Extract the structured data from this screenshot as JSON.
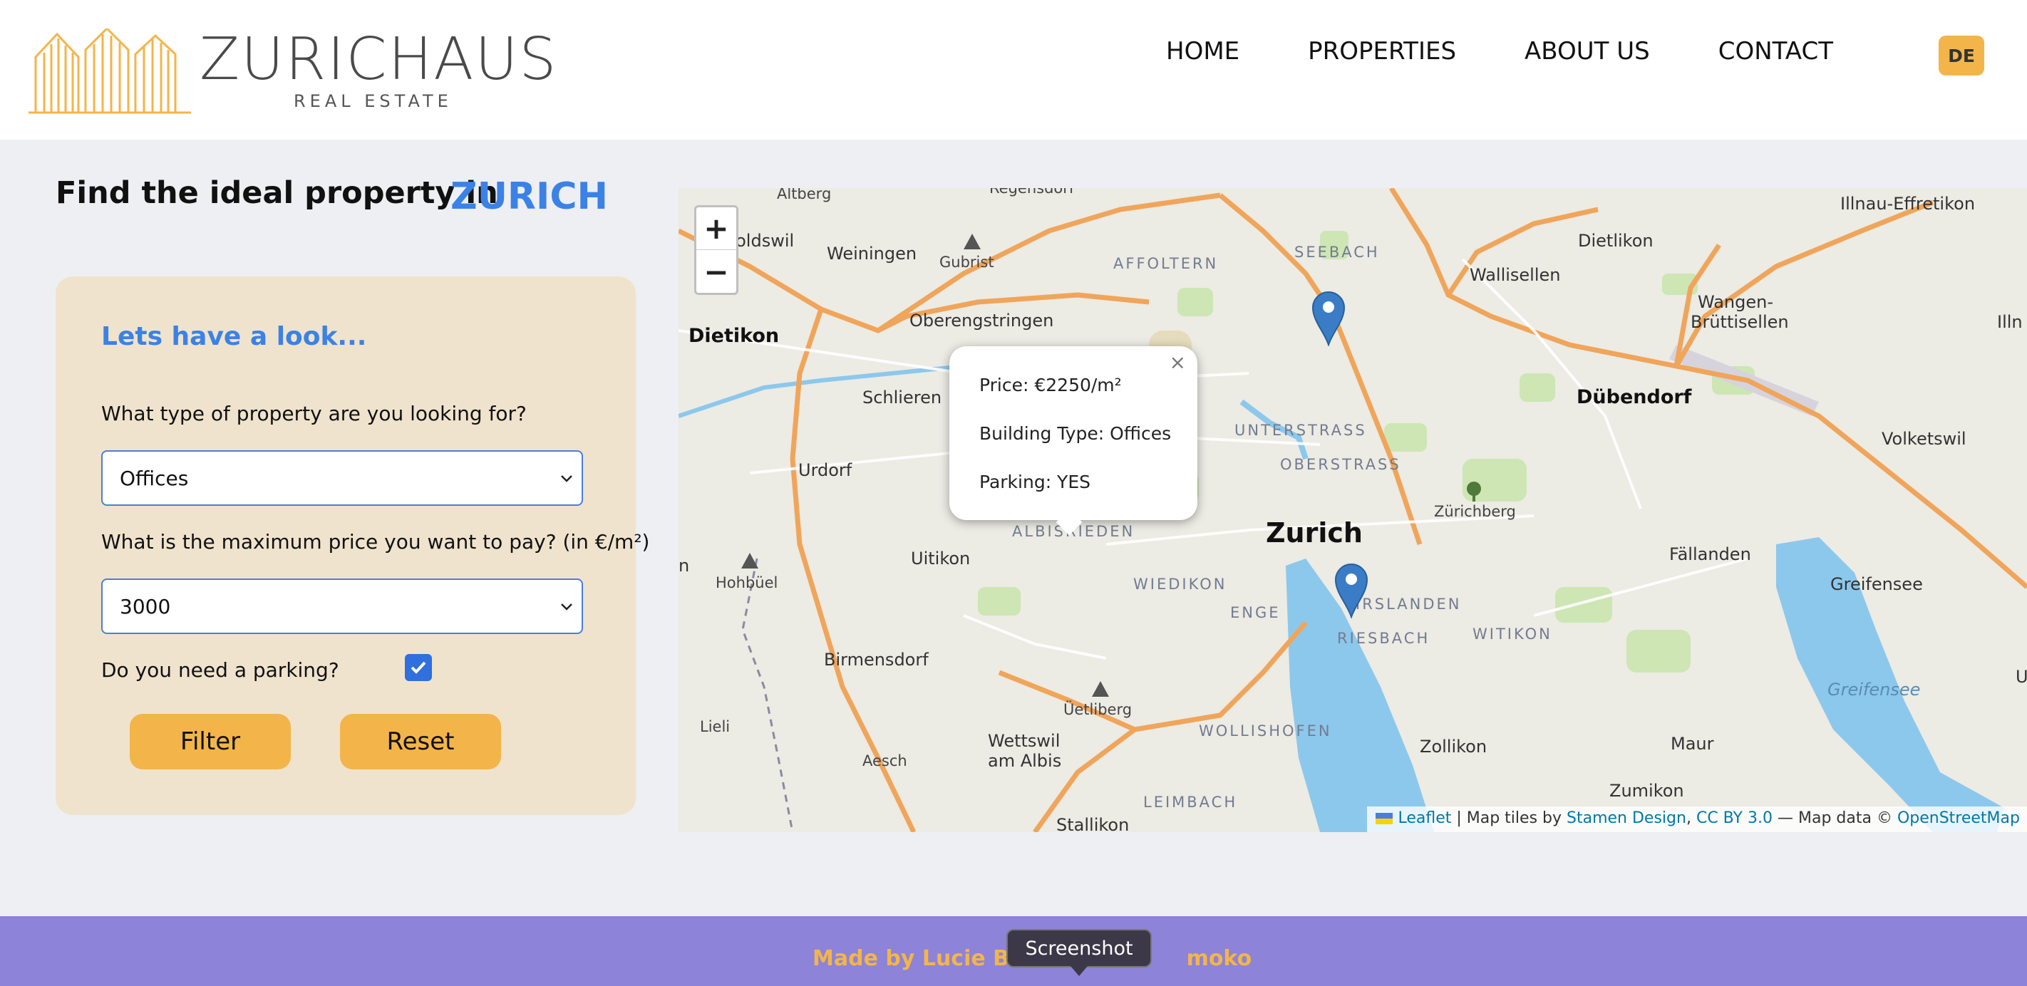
{
  "brand": {
    "name": "ZURICHAUS",
    "tagline": "REAL ESTATE",
    "logo_color": "#f3b54a"
  },
  "nav": {
    "items": [
      "HOME",
      "PROPERTIES",
      "ABOUT US",
      "CONTACT"
    ],
    "lang": "DE"
  },
  "headline": {
    "text": "Find the ideal property in",
    "city": "ZURICH"
  },
  "filter": {
    "title": "Lets have a look...",
    "type_question": "What type of property are you looking for?",
    "type_value": "Offices",
    "price_question": "What is the maximum price you want to pay? (in €/m²)",
    "price_value": "3000",
    "parking_question": "Do you need a parking?",
    "parking_checked": true,
    "filter_button": "Filter",
    "reset_button": "Reset"
  },
  "map": {
    "zoom_in": "+",
    "zoom_out": "−",
    "popup": {
      "close": "×",
      "price": "Price: €2250/m²",
      "type": "Building Type: Offices",
      "parking": "Parking: YES"
    },
    "attribution": {
      "leaflet": "Leaflet",
      "tiles_prefix": "| Map tiles by",
      "stamen": "Stamen Design",
      "cc": "CC BY 3.0",
      "data_prefix": "— Map data ©",
      "osm": "OpenStreetMap"
    },
    "places": {
      "altberg": "Altberg",
      "regensdorf": "Regensdorf",
      "geroldswil": "eroldswil",
      "weiningen": "Weiningen",
      "gubrist": "Gubrist",
      "affoltern": "AFFOLTERN",
      "seebach": "SEEBACH",
      "dietlikon": "Dietlikon",
      "illnau": "Illnau-Effretikon",
      "wallisellen": "Wallisellen",
      "wangen": "Wangen-",
      "bruttisellen": "Brüttisellen",
      "dietikon": "Dietikon",
      "oberengstringen": "Oberengstringen",
      "schlieren": "Schlieren",
      "unterstrass": "UNTERSTRASS",
      "oberstrass": "OBERSTRASS",
      "dubendorf": "Dübendorf",
      "volketswil": "Volketswil",
      "urdorf": "Urdorf",
      "zurichberg": "Zürichberg",
      "albisrieden": "ALBISRIEDEN",
      "zurich": "Zurich",
      "uitikon": "Uitikon",
      "hohbuel": "Hohbüel",
      "fallanden": "Fällanden",
      "greifensee": "Greifensee",
      "wiedikon": "WIEDIKON",
      "enge": "ENGE",
      "hirslanden": "IRSLANDEN",
      "riesbach": "RIESBACH",
      "witikon": "WITIKON",
      "birmensdorf": "Birmensdorf",
      "uetliberg": "Üetliberg",
      "greifensee_lake": "Greifensee",
      "lieli": "Lieli",
      "wettswil1": "Wettswil",
      "wettswil2": "am Albis",
      "wollishofen": "WOLLISHOFEN",
      "zollikon": "Zollikon",
      "maur": "Maur",
      "aesch": "Aesch",
      "zumikon": "Zumikon",
      "leimbach": "LEIMBACH",
      "stallikon": "Stallikon",
      "n": "n",
      "illn": "Illn",
      "u": "U"
    }
  },
  "footer": {
    "text": "Made by Lucie Bal",
    "text_end": "moko"
  },
  "tooltip": "Screenshot"
}
